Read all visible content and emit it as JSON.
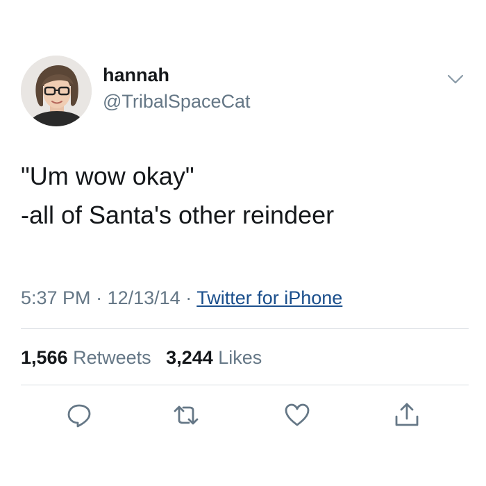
{
  "user": {
    "display_name": "hannah",
    "handle": "@TribalSpaceCat",
    "avatar_icon": "profile-photo"
  },
  "menu_icon": "chevron-down-icon",
  "tweet": {
    "lines": [
      "\"Um wow okay\"",
      "-all of Santa's other reindeer"
    ]
  },
  "meta": {
    "time": "5:37 PM",
    "separator": "·",
    "date": "12/13/14",
    "source": "Twitter for iPhone"
  },
  "stats": {
    "retweets_count": "1,566",
    "retweets_label": "Retweets",
    "likes_count": "3,244",
    "likes_label": "Likes"
  },
  "actions": [
    {
      "icon": "reply-icon"
    },
    {
      "icon": "retweet-icon"
    },
    {
      "icon": "like-heart-icon"
    },
    {
      "icon": "share-icon"
    }
  ],
  "colors": {
    "text": "#14171a",
    "secondary": "#657786",
    "link": "#1b4f8c",
    "divider": "#d8dde2"
  }
}
